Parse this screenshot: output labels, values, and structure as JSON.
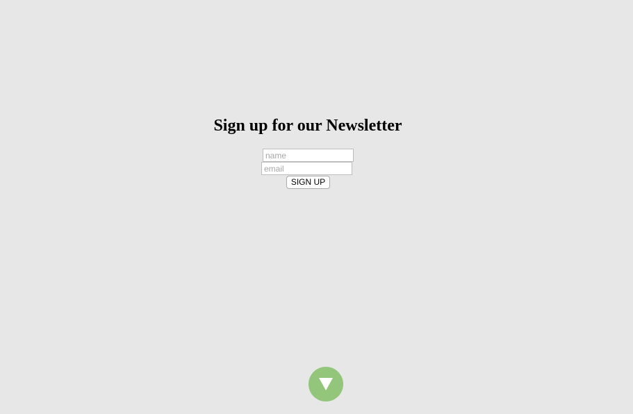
{
  "newsletter": {
    "heading": "Sign up for our Newsletter",
    "name_placeholder": "name",
    "email_placeholder": "email",
    "submit_label": "SIGN UP"
  },
  "scroll_button": {
    "icon": "triangle-down-icon",
    "color": "#93c57b"
  },
  "colors": {
    "background": "#e7e7e7",
    "accent": "#93c57b"
  }
}
